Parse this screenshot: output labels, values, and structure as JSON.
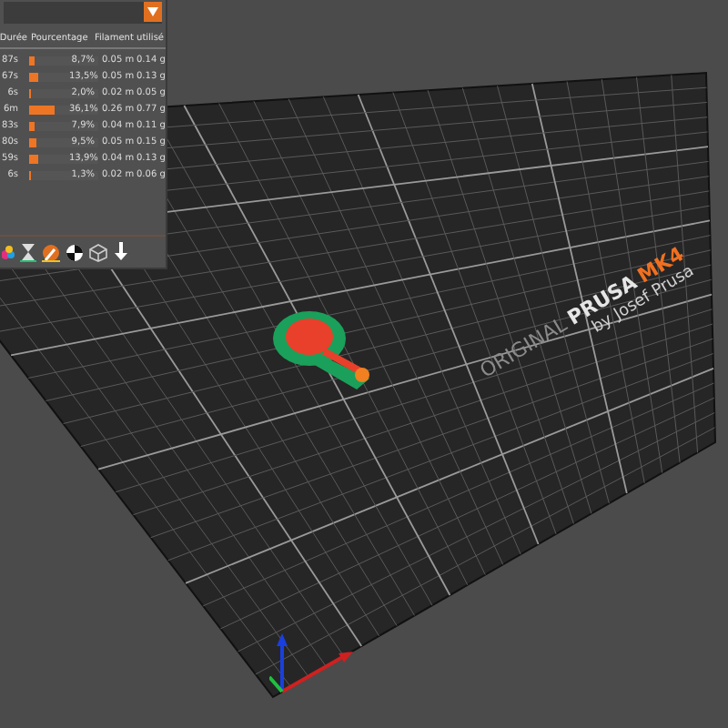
{
  "legend": {
    "columns": [
      "Durée",
      "Pourcentage",
      "Filament utilisé"
    ],
    "rows": [
      {
        "time": "87s",
        "level": 0.087,
        "percent": "8,7%",
        "length": "0.05 m",
        "weight": "0.14 g"
      },
      {
        "time": "67s",
        "level": 0.135,
        "percent": "13,5%",
        "length": "0.05 m",
        "weight": "0.13 g"
      },
      {
        "time": "6s",
        "level": 0.02,
        "percent": "2,0%",
        "length": "0.02 m",
        "weight": "0.05 g"
      },
      {
        "time": "6m",
        "level": 0.361,
        "percent": "36,1%",
        "length": "0.26 m",
        "weight": "0.77 g"
      },
      {
        "time": "83s",
        "level": 0.079,
        "percent": "7,9%",
        "length": "0.04 m",
        "weight": "0.11 g"
      },
      {
        "time": "80s",
        "level": 0.095,
        "percent": "9,5%",
        "length": "0.05 m",
        "weight": "0.15 g"
      },
      {
        "time": "59s",
        "level": 0.139,
        "percent": "13,9%",
        "length": "0.04 m",
        "weight": "0.13 g"
      },
      {
        "time": "6s",
        "level": 0.013,
        "percent": "1,3%",
        "length": "0.02 m",
        "weight": "0.06 g"
      }
    ]
  },
  "bed": {
    "logo": [
      "ORIGINAL",
      "PRUSA",
      "MK4"
    ],
    "byline": "by Josef Prusa"
  }
}
